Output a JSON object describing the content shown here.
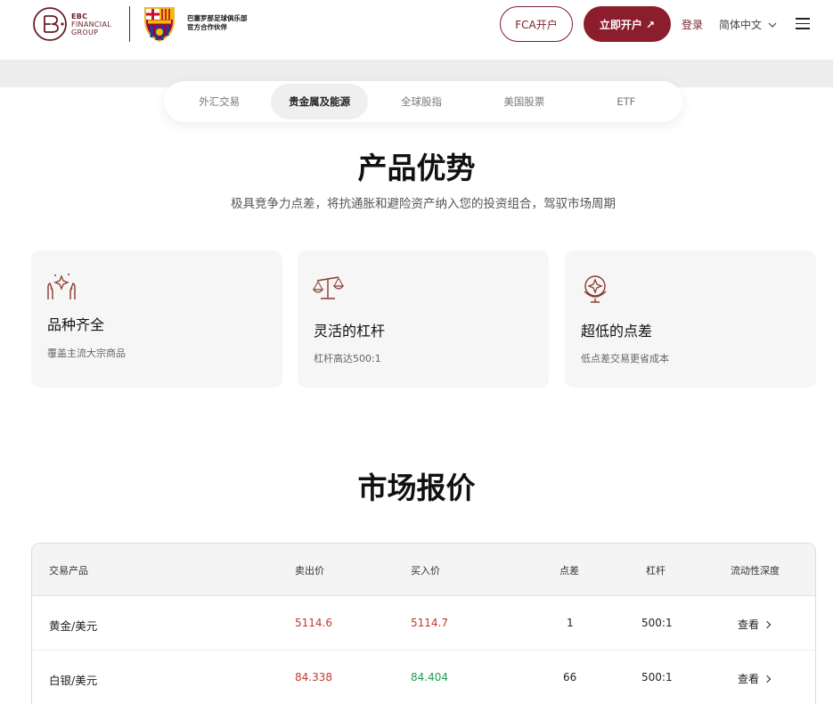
{
  "header": {
    "brand_lines": [
      "EBC",
      "FINANCIAL",
      "GROUP"
    ],
    "partner_line1": "巴塞罗那足球俱乐部",
    "partner_line2": "官方合作伙伴",
    "fca_button": "FCA开户",
    "open_button": "立即开户 ↗",
    "login": "登录",
    "language": "简体中文"
  },
  "tabs": [
    {
      "label": "外汇交易",
      "active": false
    },
    {
      "label": "贵金属及能源",
      "active": true
    },
    {
      "label": "全球股指",
      "active": false
    },
    {
      "label": "美国股票",
      "active": false
    },
    {
      "label": "ETF",
      "active": false
    }
  ],
  "advantages": {
    "title": "产品优势",
    "subtitle": "极具竞争力点差，将抗通胀和避险资产纳入您的投资组合，驾驭市场周期",
    "cards": [
      {
        "icon": "hands-sparkle-icon",
        "title": "品种齐全",
        "desc": "覆盖主流大宗商品"
      },
      {
        "icon": "balance-scale-icon",
        "title": "灵活的杠杆",
        "desc": "杠杆高达500:1"
      },
      {
        "icon": "globe-sparkle-icon",
        "title": "超低的点差",
        "desc": "低点差交易更省成本"
      }
    ]
  },
  "quotes": {
    "title": "市场报价",
    "columns": [
      "交易产品",
      "卖出价",
      "买入价",
      "点差",
      "杠杆",
      "流动性深度"
    ],
    "rows": [
      {
        "name": "黄金/美元",
        "sell": "5114.6",
        "buy": "5114.7",
        "buy_color": "red",
        "spread": "1",
        "leverage": "500:1",
        "action": "查看"
      },
      {
        "name": "白银/美元",
        "sell": "84.338",
        "buy": "84.404",
        "buy_color": "green",
        "spread": "66",
        "leverage": "500:1",
        "action": "查看"
      }
    ]
  },
  "colors": {
    "brand": "#8c1d2d",
    "sell": "#c0392b",
    "buy_up": "#1e9e53"
  }
}
